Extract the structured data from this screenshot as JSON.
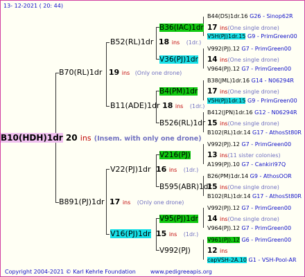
{
  "header": {
    "date": "13- 12-2021 ( 20: 44)"
  },
  "root": {
    "name": "B10(HDH)1dr",
    "num": "20",
    "ins": "ins",
    "note": "(Insem. with only one drone)"
  },
  "gen1": [
    {
      "name": "B70(RL)1dr",
      "num": "19",
      "ins": "ins",
      "note": "(Only one drone)"
    },
    {
      "name": "B891(PJ)1dr",
      "num": "17",
      "ins": "ins",
      "note": "(Only one drone)"
    }
  ],
  "gen2": [
    {
      "name": "B52(RL)1dr",
      "num": "18",
      "ins": "ins",
      "note": "(1dr.)"
    },
    {
      "name": "B11(ADE)1dr",
      "num": "18",
      "ins": "ins",
      "note": "(1dr.)"
    },
    {
      "name": "V22(PJ)1dr",
      "num": "16",
      "ins": "ins",
      "note": "(1dr.)"
    },
    {
      "name": "V16(PJ)1dr",
      "num": "15",
      "ins": "ins",
      "note": "(1dr.)"
    }
  ],
  "gen3": [
    {
      "name": "B36(IAC)1dr",
      "num": "17",
      "ins": "ins",
      "note": "(One single drone)"
    },
    {
      "name": "V36(PJ)1dr",
      "num": "14",
      "ins": "ins",
      "note": "(One single drone)"
    },
    {
      "name": "B4(PM)1dr",
      "num": "17",
      "ins": "ins",
      "note": "(One single drone)"
    },
    {
      "name": "B526(RL)1dr",
      "num": "15",
      "ins": "ins",
      "note": "(One single drone)"
    },
    {
      "name": "V216(PJ)",
      "num": "13",
      "ins": "ins",
      "note": "(11 sister colonies)"
    },
    {
      "name": "B595(ABR)1dr",
      "num": "15",
      "ins": "ins",
      "note": "(One single drone)"
    },
    {
      "name": "V95(PJ)1dr",
      "num": "14",
      "ins": "ins",
      "note": "(One single drone)"
    },
    {
      "name": "V992(PJ)",
      "num": "12",
      "ins": "ins",
      "note": ""
    }
  ],
  "gen4": [
    {
      "name": "B44(DS)1dr.16",
      "code": "G26",
      "breeder": "Sinop62R"
    },
    {
      "name": "V5H(PJ)1dr.15",
      "code": "G9",
      "breeder": "PrimGreen00"
    },
    {
      "name": "V992(PJ).12",
      "code": "G7",
      "breeder": "PrimGreen00"
    },
    {
      "name": "V964(PJ).12",
      "code": "G7",
      "breeder": "PrimGreen00"
    },
    {
      "name": "B38(JML)1dr.16",
      "code": "G14",
      "breeder": "N06294R"
    },
    {
      "name": "V5H(PJ)1dr.15",
      "code": "G9",
      "breeder": "PrimGreen00"
    },
    {
      "name": "B412(JPN)1dr.16",
      "code": "G12",
      "breeder": "N06294R"
    },
    {
      "name": "B102(RL)1dr.14",
      "code": "G17",
      "breeder": "AthosSt80R"
    },
    {
      "name": "V992(PJ).12",
      "code": "G7",
      "breeder": "PrimGreen00"
    },
    {
      "name": "A199(PJ).10",
      "code": "G7",
      "breeder": "Cankiri97Q"
    },
    {
      "name": "B26(PM)1dr.14",
      "code": "G9",
      "breeder": "AthosOOR"
    },
    {
      "name": "B102(RL)1dr.14",
      "code": "G17",
      "breeder": "AthosSt80R"
    },
    {
      "name": "V992(PJ).12",
      "code": "G7",
      "breeder": "PrimGreen00"
    },
    {
      "name": "V964(PJ).12",
      "code": "G7",
      "breeder": "PrimGreen00"
    },
    {
      "name": "V961(PJ).12",
      "code": "G6",
      "breeder": "PrimGreen00"
    },
    {
      "name": "capVSH-2A.10",
      "code": "G1",
      "breeder": "VSH-Pool-AR"
    }
  ],
  "footer": {
    "copyright": "Copyright 2004-2021 © Karl Kehrle Foundation",
    "site": "www.pedigreeapis.org"
  },
  "colors": {
    "green": "#10c810",
    "cyan": "#18e0e8",
    "pink": "#f0c0f0",
    "ins": "#c00000",
    "link": "#1010c8"
  }
}
